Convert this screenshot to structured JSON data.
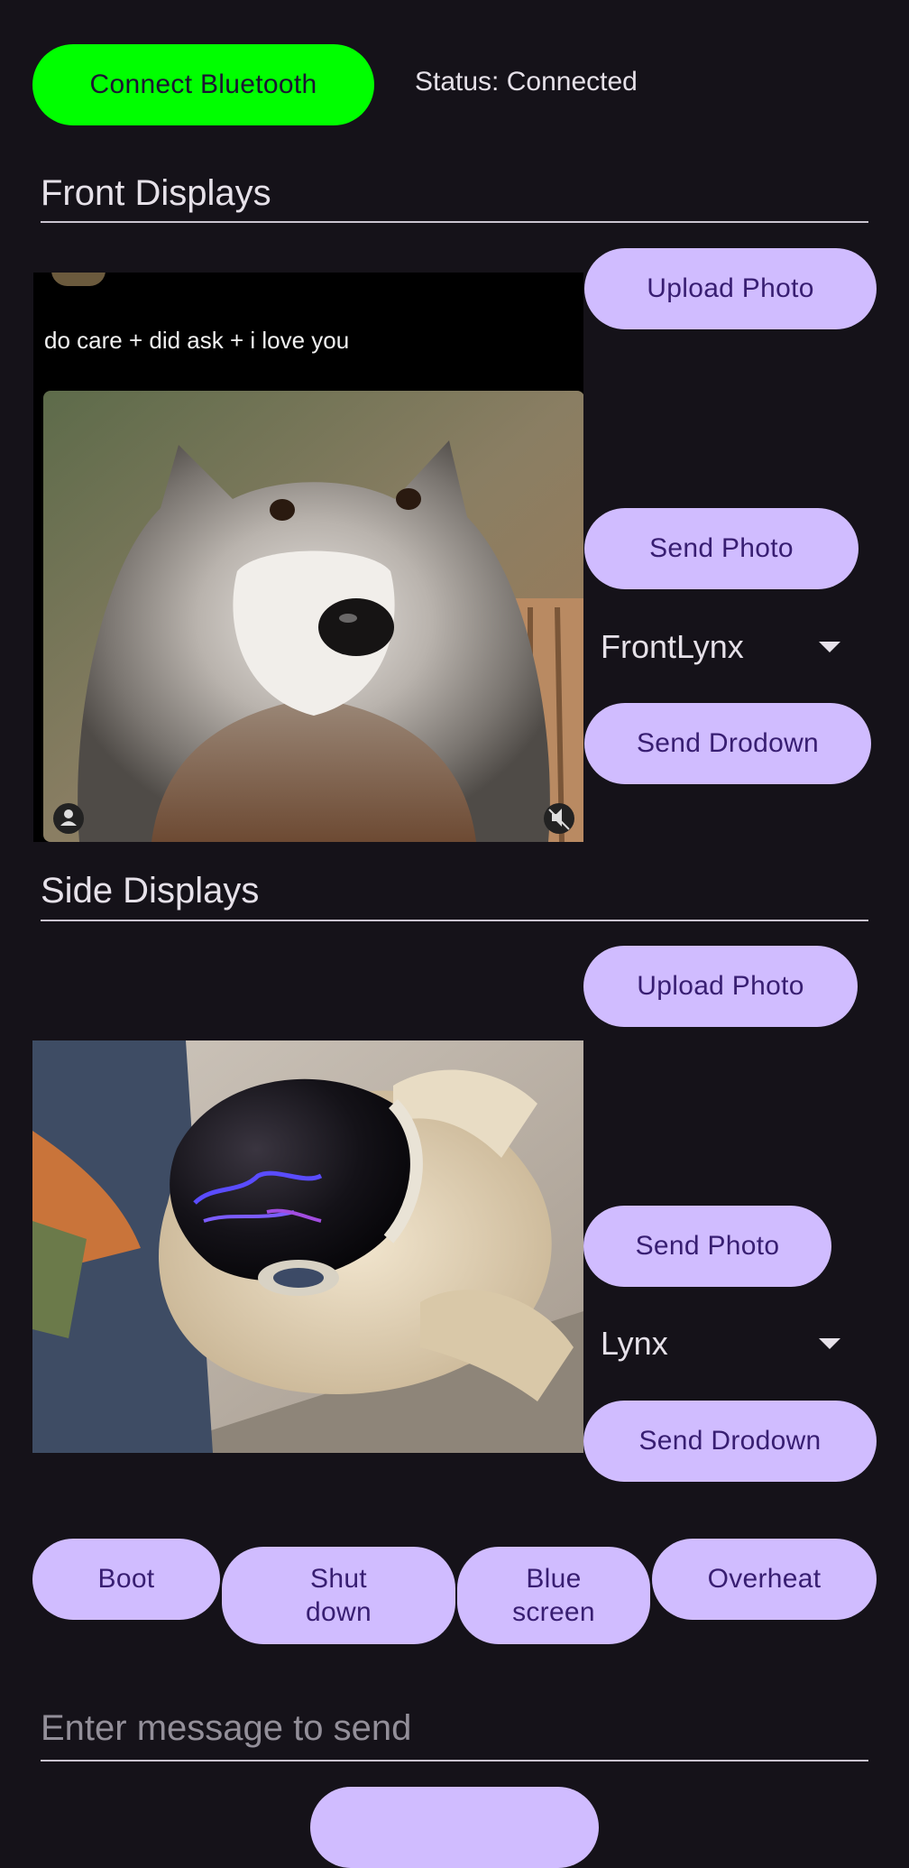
{
  "header": {
    "connect_label": "Connect Bluetooth",
    "status_text": "Status: Connected",
    "connect_color": "#00ff00"
  },
  "front": {
    "heading": "Front Displays",
    "upload_label": "Upload Photo",
    "send_photo_label": "Send Photo",
    "dropdown_value": "FrontLynx",
    "send_dropdown_label": "Send Drodown",
    "image_caption": "do care + did ask + i love you"
  },
  "side": {
    "heading": "Side Displays",
    "upload_label": "Upload Photo",
    "send_photo_label": "Send Photo",
    "dropdown_value": "Lynx",
    "send_dropdown_label": "Send Drodown"
  },
  "actions": {
    "boot": "Boot",
    "shutdown": "Shut\ndown",
    "bluescreen": "Blue\nscreen",
    "overheat": "Overheat"
  },
  "message": {
    "placeholder": "Enter message to send"
  },
  "colors": {
    "background": "#151219",
    "button": "#d0bcff",
    "button_text": "#381e72"
  }
}
